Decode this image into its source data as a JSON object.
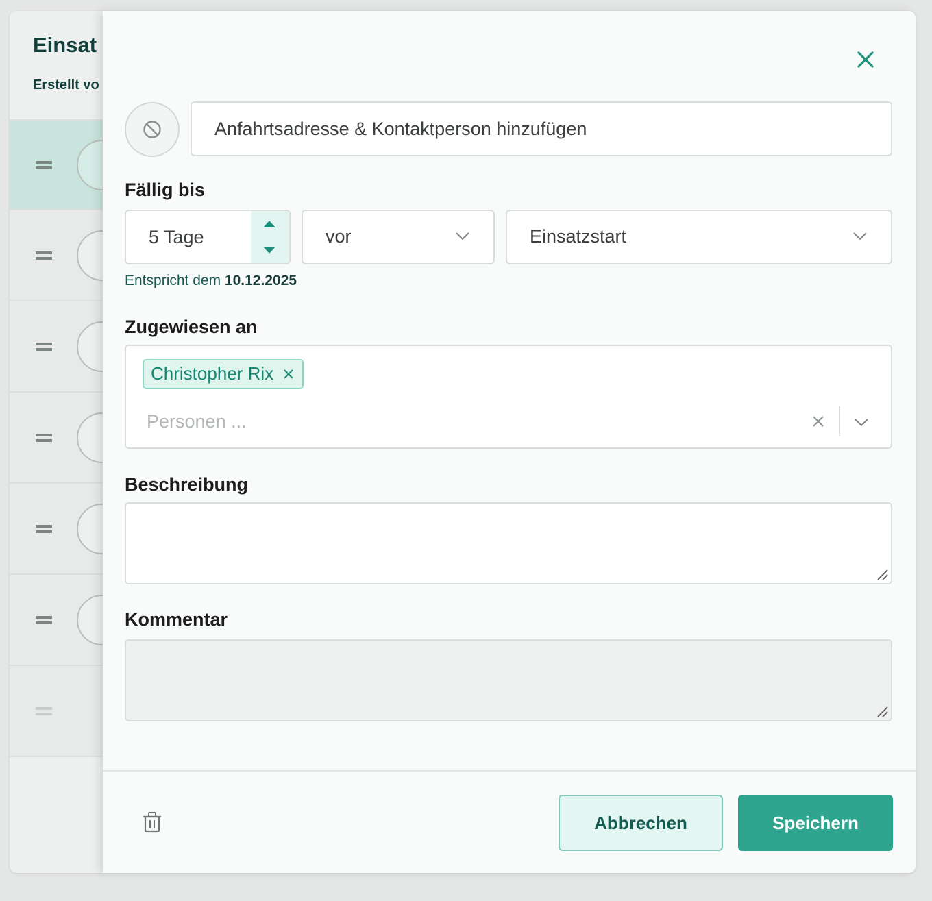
{
  "background": {
    "title": "Einsat",
    "subtitle": "Erstellt vo"
  },
  "task": {
    "title_value": "Anfahrtsadresse & Kontaktperson hinzufügen",
    "status_icon": "blocked-circle-icon"
  },
  "due": {
    "label": "Fällig bis",
    "amount_value": "5 Tage",
    "relation_value": "vor",
    "reference_value": "Einsatzstart",
    "hint_prefix": "Entspricht dem",
    "hint_date": "10.12.2025"
  },
  "assigned": {
    "label": "Zugewiesen an",
    "chips": [
      {
        "name": "Christopher Rix"
      }
    ],
    "placeholder": "Personen ..."
  },
  "description": {
    "label": "Beschreibung",
    "value": ""
  },
  "comment": {
    "label": "Kommentar",
    "value": ""
  },
  "footer": {
    "cancel_label": "Abbrechen",
    "save_label": "Speichern"
  },
  "colors": {
    "accent": "#2fa48f",
    "accent_light": "#e3f6f1",
    "text_dark_green": "#12403a"
  }
}
